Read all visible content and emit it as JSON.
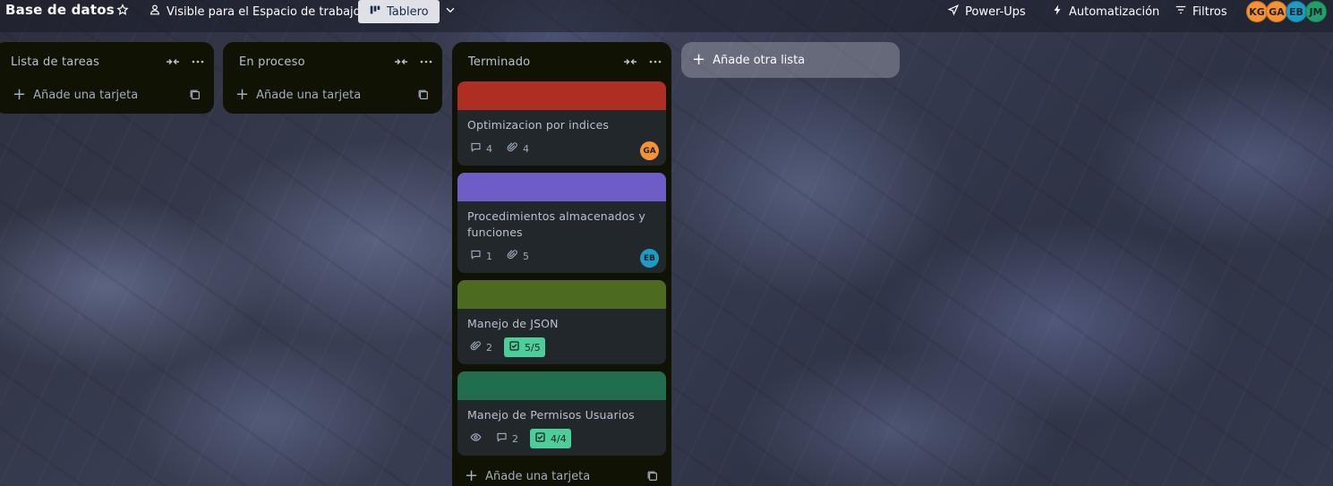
{
  "board": {
    "title": "Base de datos",
    "visibility_label": "Visible para el Espacio de trabajo",
    "view_label": "Tablero"
  },
  "header_right": {
    "powerups_label": "Power-Ups",
    "automation_label": "Automatización",
    "filters_label": "Filtros",
    "members": [
      {
        "initials": "KG",
        "color": "#f79233"
      },
      {
        "initials": "GA",
        "color": "#f79233"
      },
      {
        "initials": "EB",
        "color": "#1d9bc4"
      },
      {
        "initials": "JM",
        "color": "#22a06b"
      }
    ]
  },
  "lists": [
    {
      "title": "Lista de tareas",
      "add_card_label": "Añade una tarjeta"
    },
    {
      "title": "En proceso",
      "add_card_label": "Añade una tarjeta"
    },
    {
      "title": "Terminado",
      "add_card_label": "Añade una tarjeta",
      "cards": [
        {
          "title": "Optimizacion por indices",
          "cover": "#ae2e24",
          "comments": "4",
          "attachments": "4",
          "member": "GA",
          "member_color": "#f79233"
        },
        {
          "title": "Procedimientos almacenados y funciones",
          "cover": "#6e5dc6",
          "comments": "1",
          "attachments": "5",
          "member": "EB",
          "member_color": "#1d9bc4"
        },
        {
          "title": "Manejo de JSON",
          "cover": "#4c6b1f",
          "attachments": "2",
          "checklist": "5/5"
        },
        {
          "title": "Manejo de Permisos Usuarios",
          "cover": "#216e4e",
          "comments": "2",
          "checklist": "4/4"
        }
      ]
    }
  ],
  "add_list_label": "Añade otra lista"
}
